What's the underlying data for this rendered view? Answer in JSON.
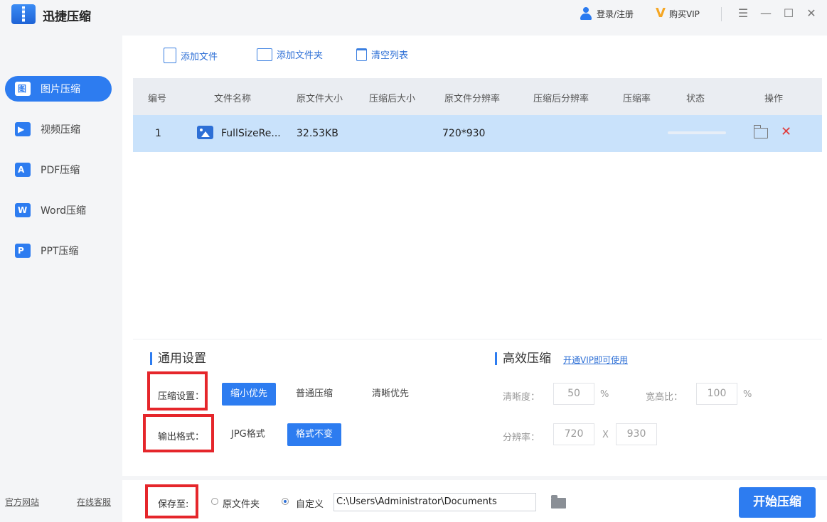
{
  "app": {
    "title": "迅捷压缩",
    "login_label": "登录/注册",
    "vip_label": "购买VIP"
  },
  "window_controls": {
    "menu_icon": "☰",
    "minimize_icon": "—",
    "maximize_icon": "☐",
    "close_icon": "✕"
  },
  "sidebar": {
    "items": [
      {
        "label": "图片压缩",
        "icon_glyph": "图",
        "active": true
      },
      {
        "label": "视频压缩",
        "icon_glyph": "▶",
        "active": false
      },
      {
        "label": "PDF压缩",
        "icon_glyph": "A",
        "active": false
      },
      {
        "label": "Word压缩",
        "icon_glyph": "W",
        "active": false
      },
      {
        "label": "PPT压缩",
        "icon_glyph": "P",
        "active": false
      }
    ],
    "footer": {
      "website": "官方网站",
      "support": "在线客服"
    }
  },
  "toolbar": {
    "add_file": "添加文件",
    "add_folder": "添加文件夹",
    "clear_list": "清空列表"
  },
  "table": {
    "headers": [
      "编号",
      "文件名称",
      "原文件大小",
      "压缩后大小",
      "原文件分辨率",
      "压缩后分辨率",
      "压缩率",
      "状态",
      "操作"
    ],
    "rows": [
      {
        "index": "1",
        "name": "FullSizeRe...",
        "original_size": "32.53KB",
        "compressed_size": "",
        "original_res": "720*930",
        "compressed_res": "",
        "ratio": "",
        "progress": 0
      }
    ]
  },
  "general_settings": {
    "title": "通用设置",
    "compress_label": "压缩设置：",
    "compress_options": [
      "缩小优先",
      "普通压缩",
      "清晰优先"
    ],
    "compress_selected": "缩小优先",
    "format_label": "输出格式：",
    "format_options": [
      "JPG格式",
      "格式不变"
    ],
    "format_selected": "格式不变"
  },
  "efficient_settings": {
    "title": "高效压缩",
    "vip_link": "开通VIP即可使用",
    "clarity_label": "清晰度：",
    "clarity_value": "50",
    "clarity_unit": "%",
    "aspect_label": "宽高比：",
    "aspect_value": "100",
    "aspect_unit": "%",
    "resolution_label": "分辨率：",
    "res_width": "720",
    "res_sep": "X",
    "res_height": "930"
  },
  "save": {
    "label": "保存至:",
    "option_original": "原文件夹",
    "option_custom": "自定义",
    "selected": "custom",
    "path": "C:\\Users\\Administrator\\Documents"
  },
  "start_button": "开始压缩",
  "colors": {
    "accent": "#2d7cf0",
    "highlight": "#e5262b",
    "row_selected": "#c9e2fb"
  }
}
